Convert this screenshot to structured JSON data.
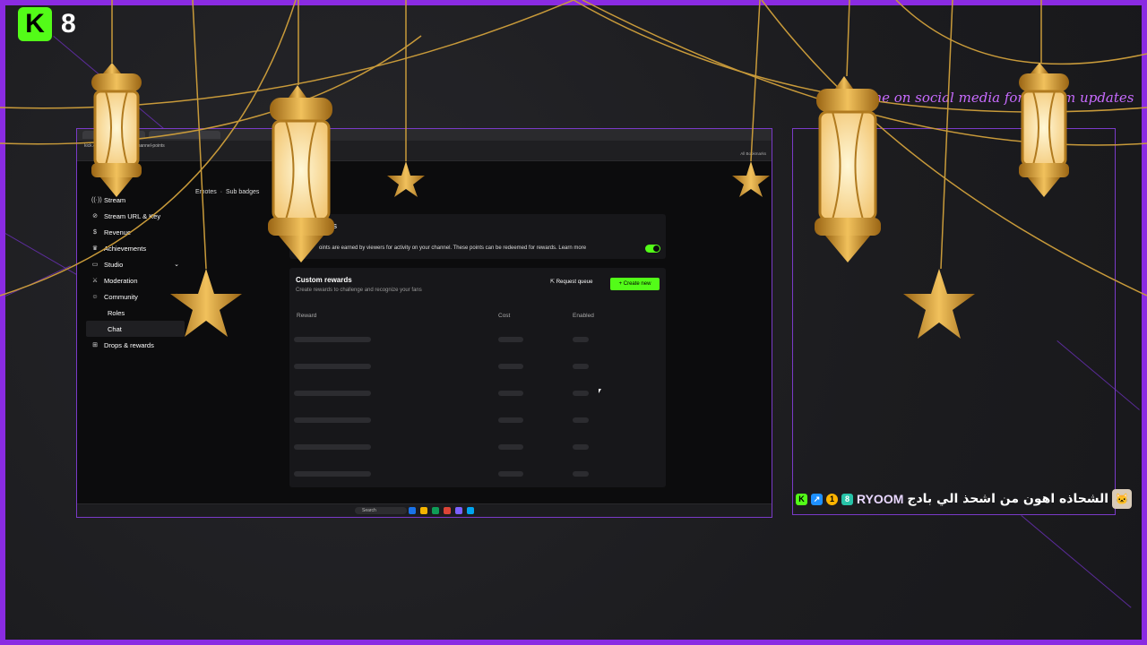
{
  "overlay": {
    "logo_letter": "K",
    "logo_number": "8",
    "promo_text": "Follow me on social media for stream updates",
    "accent_color": "#8a2be2",
    "kick_green": "#53fc18"
  },
  "browser": {
    "url": "kick.com/community/chat/channel-points",
    "bookmark": "All Bookmarks"
  },
  "sidebar": {
    "items": [
      {
        "label": "Stream",
        "icon": "broadcast-icon"
      },
      {
        "label": "Stream URL & Key",
        "icon": "link-icon"
      },
      {
        "label": "Revenue",
        "icon": "dollar-icon"
      },
      {
        "label": "Achievements",
        "icon": "trophy-icon"
      },
      {
        "label": "Studio",
        "icon": "monitor-icon"
      },
      {
        "label": "Moderation",
        "icon": "sword-icon"
      },
      {
        "label": "Community",
        "icon": "people-icon"
      },
      {
        "label": "Roles",
        "icon": ""
      },
      {
        "label": "Chat",
        "icon": ""
      },
      {
        "label": "Drops & rewards",
        "icon": "gift-icon"
      }
    ]
  },
  "tabs": {
    "emotes": "Emotes",
    "sub_badges": "Sub badges"
  },
  "channel_points": {
    "title": "nts",
    "description": "oints are earned by viewers for activity on your channel. These points can be redeemed for rewards. Learn more",
    "enabled": true
  },
  "custom_rewards": {
    "title": "Custom rewards",
    "description": "Create rewards to challenge and recognize your fans",
    "request_queue": "Request queue",
    "create_new": "+ Create new",
    "columns": [
      "Reward",
      "Cost",
      "Enabled"
    ],
    "loading_rows": 6
  },
  "taskbar": {
    "search": "Search"
  },
  "chat": {
    "username": "RYOOM",
    "message": "الشحاذه اهون من اشحذ الي بادج",
    "badges": [
      "K",
      "↗",
      "1",
      "8"
    ]
  }
}
